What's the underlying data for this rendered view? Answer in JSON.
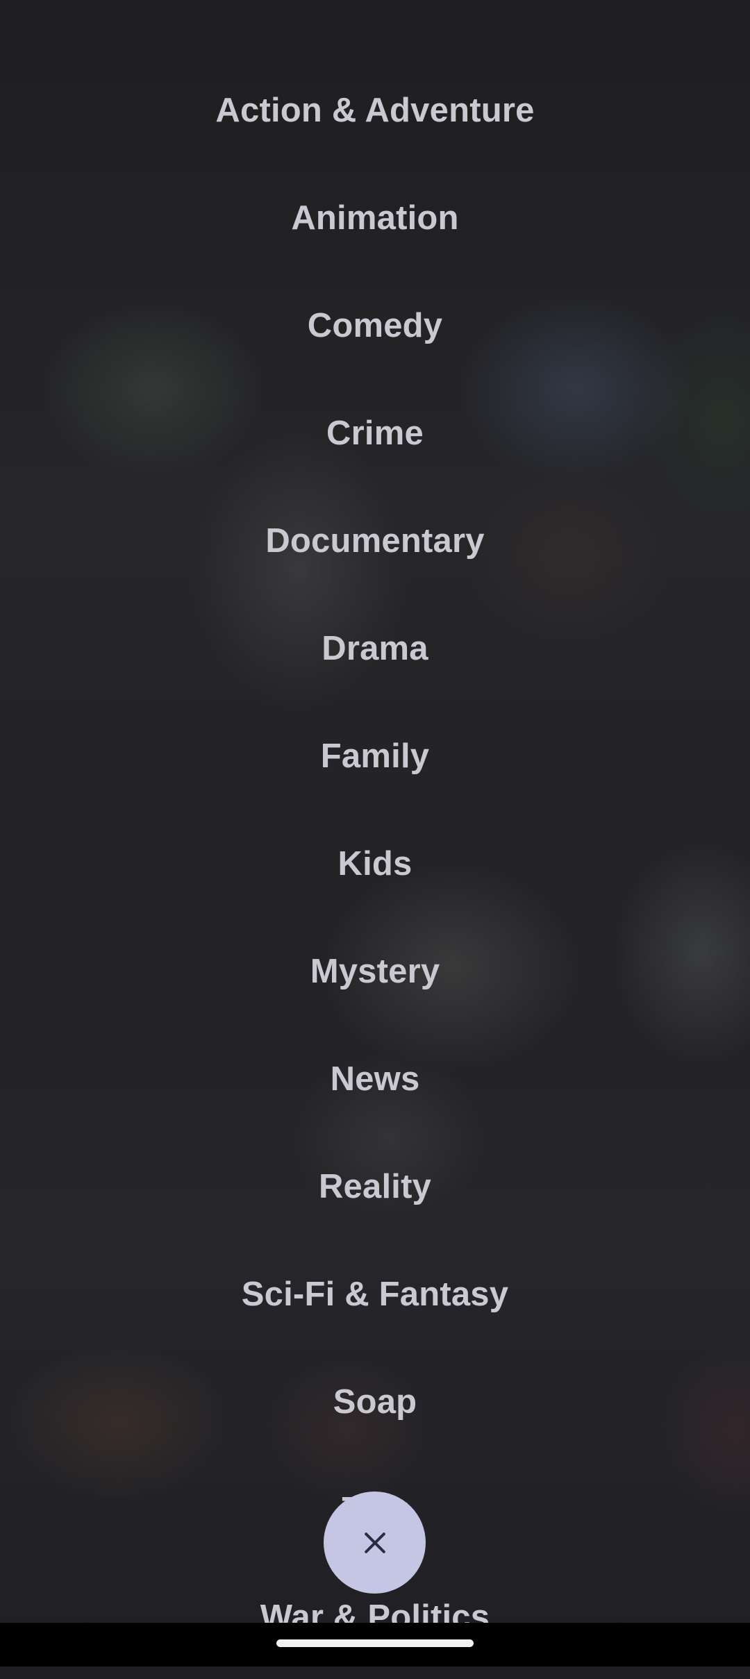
{
  "genres": [
    "Action & Adventure",
    "Animation",
    "Comedy",
    "Crime",
    "Documentary",
    "Drama",
    "Family",
    "Kids",
    "Mystery",
    "News",
    "Reality",
    "Sci-Fi & Fantasy",
    "Soap",
    "Talk",
    "War & Politics"
  ],
  "close_button": {
    "icon": "close-icon"
  },
  "colors": {
    "genre_text": "#c9c9d2",
    "fab_background": "#c4c6e3",
    "fab_icon": "#2b2d42",
    "background": "#1f1f22"
  }
}
